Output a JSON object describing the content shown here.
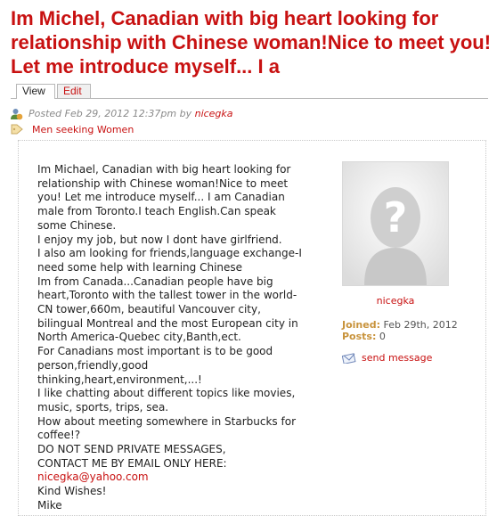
{
  "node": {
    "title": "Im Michel, Canadian with big heart looking for relationship with Chinese woman!Nice to meet you! Let me introduce myself... I a"
  },
  "tabs": [
    {
      "label": "View"
    },
    {
      "label": "Edit"
    }
  ],
  "meta": {
    "posted_prefix": "Posted Feb 29, 2012 12:37pm by ",
    "author": "nicegka",
    "tag": "Men seeking Women"
  },
  "body_lines": [
    "Im Michael, Canadian with big heart looking for",
    "relationship with Chinese woman!Nice to meet",
    "you! Let me introduce myself... I am Canadian",
    "male from Toronto.I teach English.Can speak",
    "some Chinese.",
    "I enjoy my job, but now I dont have girlfriend.",
    "I also am looking for friends,language exchange-I",
    "need some help with learning Chinese",
    "Im from Canada...Canadian people have big",
    "heart,Toronto with the tallest tower in the world-",
    "CN tower,660m, beautiful Vancouver city,",
    "bilingual Montreal and the most European city in",
    "North America-Quebec city,Banth,ect.",
    "For Canadians most important is to be good",
    "person,friendly,good",
    "thinking,heart,environment,...!",
    "I like chatting about different topics like movies,",
    "music, sports, trips, sea.",
    "How about meeting somewhere in Starbucks for",
    "coffee!?",
    "DO NOT SEND PRIVATE MESSAGES,",
    "CONTACT ME BY EMAIL ONLY HERE:"
  ],
  "email": "nicegka@yahoo.com",
  "closing_lines": [
    "Kind Wishes!",
    "Mike"
  ],
  "profile": {
    "name": "nicegka",
    "joined_label": "Joined:",
    "joined_value": "Feb 29th, 2012",
    "posts_label": "Posts:",
    "posts_value": "0",
    "send_message": "send message"
  },
  "icons": {
    "user": "user-icon",
    "tag": "tag-icon",
    "mail": "mail-icon",
    "avatar": "question-mark-avatar"
  },
  "colors": {
    "accent": "#c81111",
    "label": "#c8933c"
  }
}
